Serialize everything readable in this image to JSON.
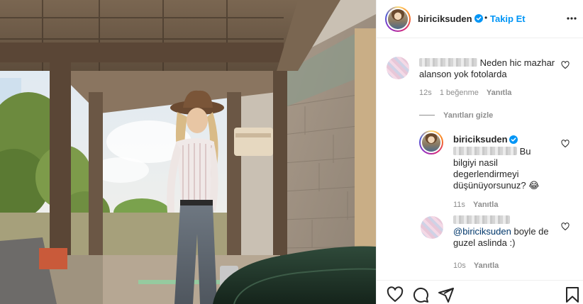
{
  "post_author": {
    "username": "biriciksuden",
    "follow_label": "Takip Et",
    "separator": "•"
  },
  "comments": [
    {
      "text": "Neden hic mazhar alanson yok fotolarda",
      "time": "12s",
      "likes": "1 beğenme",
      "reply_label": "Yanıtla"
    }
  ],
  "hide_replies_label": "Yanıtları gizle",
  "replies": [
    {
      "username": "biriciksuden",
      "text_after_mention": "Bu bilgiyi nasil degerlendirmeyi düşünüyorsunuz? 😂",
      "time": "11s",
      "reply_label": "Yanıtla"
    },
    {
      "mention": "@biriciksuden",
      "text": "boyle de guzel aslinda :)",
      "time": "10s",
      "reply_label": "Yanıtla"
    }
  ],
  "icons": {
    "verified": "verified-badge-icon",
    "more": "more-options-icon",
    "like": "heart-icon",
    "comment": "comment-icon",
    "share": "share-icon",
    "save": "bookmark-icon"
  },
  "colors": {
    "link_blue": "#0095f6",
    "text": "#262626",
    "meta": "#8e8e8e",
    "mention": "#00376b",
    "border": "#efefef"
  }
}
